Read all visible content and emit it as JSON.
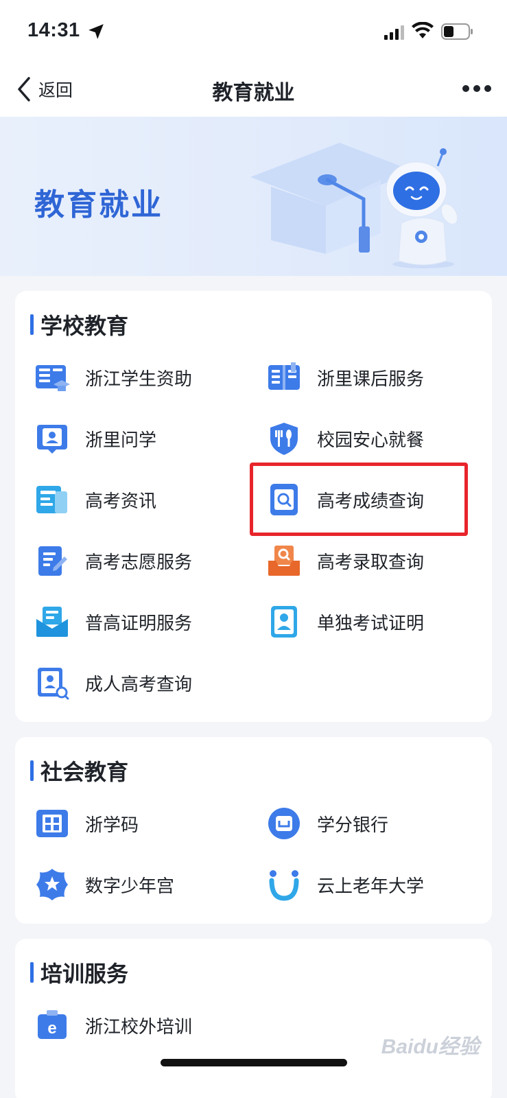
{
  "status_bar": {
    "time": "14:31"
  },
  "nav": {
    "back_label": "返回",
    "title": "教育就业"
  },
  "banner": {
    "title": "教育就业"
  },
  "sections": [
    {
      "title": "学校教育",
      "items": [
        {
          "label": "浙江学生资助",
          "icon": "book-cap-icon"
        },
        {
          "label": "浙里课后服务",
          "icon": "open-book-icon"
        },
        {
          "label": "浙里问学",
          "icon": "badge-person-icon"
        },
        {
          "label": "校园安心就餐",
          "icon": "shield-utensils-icon"
        },
        {
          "label": "高考资讯",
          "icon": "news-icon"
        },
        {
          "label": "高考成绩查询",
          "icon": "search-card-icon"
        },
        {
          "label": "高考志愿服务",
          "icon": "edit-document-icon"
        },
        {
          "label": "高考录取查询",
          "icon": "tray-search-icon"
        },
        {
          "label": "普高证明服务",
          "icon": "envelope-doc-icon"
        },
        {
          "label": "单独考试证明",
          "icon": "id-card-icon"
        },
        {
          "label": "成人高考查询",
          "icon": "person-search-icon"
        }
      ]
    },
    {
      "title": "社会教育",
      "items": [
        {
          "label": "浙学码",
          "icon": "qr-book-icon"
        },
        {
          "label": "学分银行",
          "icon": "bank-circle-icon"
        },
        {
          "label": "数字少年宫",
          "icon": "star-badge-icon"
        },
        {
          "label": "云上老年大学",
          "icon": "smile-arc-icon"
        }
      ]
    },
    {
      "title": "培训服务",
      "items": [
        {
          "label": "浙江校外培训",
          "icon": "e-board-icon"
        }
      ]
    }
  ],
  "highlighted_item": "高考成绩查询",
  "watermark": "Baidu经验",
  "colors": {
    "accent": "#2f6fe4",
    "highlight": "#e8242b",
    "banner_title": "#2f66d6"
  }
}
